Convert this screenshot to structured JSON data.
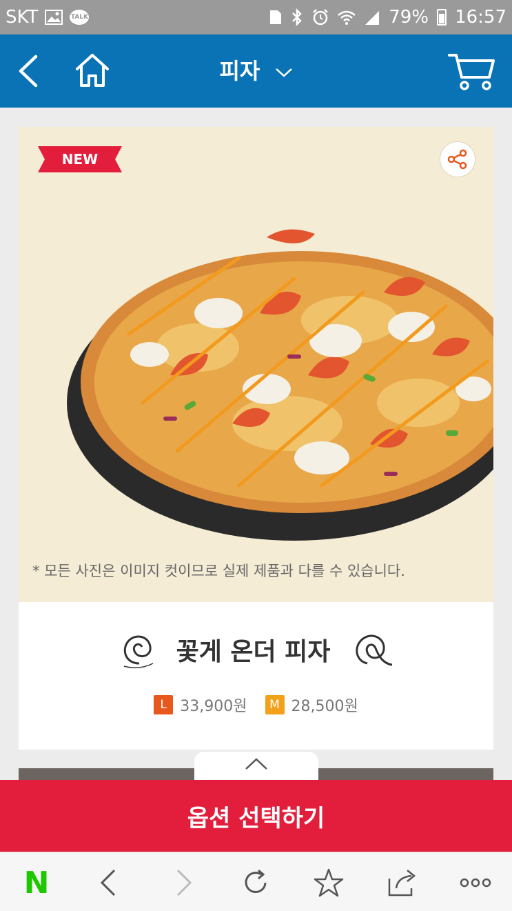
{
  "status_bar": {
    "carrier": "SKT",
    "talk_label": "TALK",
    "battery": "79%",
    "time": "16:57",
    "icons": [
      "image-icon",
      "talk-icon",
      "sim-icon",
      "bluetooth-icon",
      "alarm-icon",
      "wifi-icon",
      "signal-icon",
      "battery-icon"
    ]
  },
  "header": {
    "title": "피자",
    "icons": [
      "back-icon",
      "home-icon",
      "chevron-down-icon",
      "cart-icon"
    ],
    "bg_color": "#0a73b6"
  },
  "product": {
    "badge": "NEW",
    "disclaimer": "* 모든 사진은 이미지 컷이므로 실제 제품과 다를 수 있습니다.",
    "name": "꽃게 온더 피자",
    "prices": [
      {
        "size": "L",
        "price": "33,900원",
        "color": "#e8581c"
      },
      {
        "size": "M",
        "price": "28,500원",
        "color": "#f2a21a"
      }
    ]
  },
  "action": {
    "option_label": "옵션 선택하기",
    "color": "#e21e3c"
  },
  "browser_bar": {
    "naver_label": "N",
    "icons": [
      "naver-icon",
      "back-icon",
      "forward-icon",
      "refresh-icon",
      "bookmark-star-icon",
      "share-icon",
      "more-icon"
    ]
  }
}
